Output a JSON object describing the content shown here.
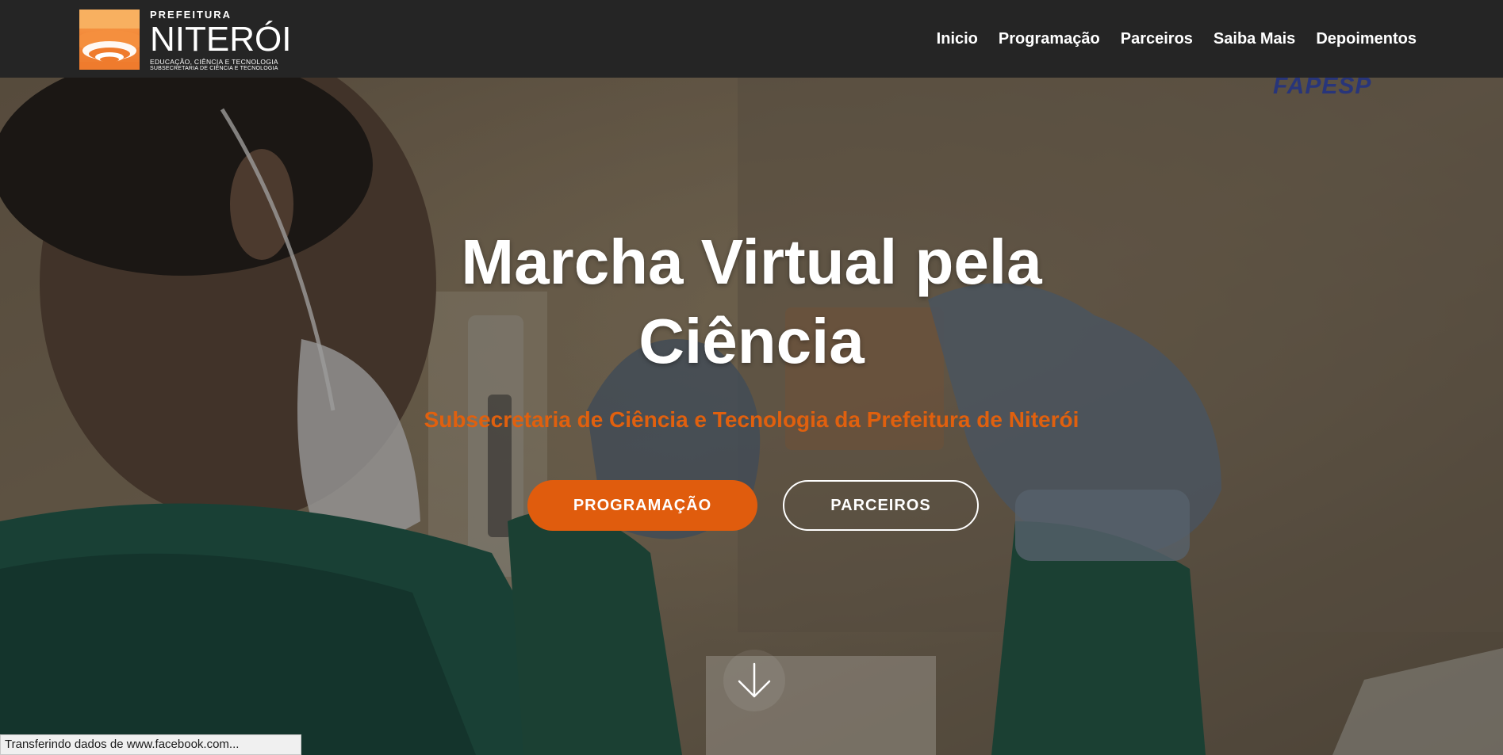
{
  "header": {
    "logo": {
      "pre_title": "PREFEITURA",
      "name": "NITERÓI",
      "subtitle1": "EDUCAÇÃO, CIÊNCIA E TECNOLOGIA",
      "subtitle2": "SUBSECRETARIA DE CIÊNCIA E TECNOLOGIA"
    },
    "nav": [
      "Inicio",
      "Programação",
      "Parceiros",
      "Saiba Mais",
      "Depoimentos"
    ]
  },
  "hero": {
    "background_text": "FAPESP",
    "title_line1": "Marcha Virtual pela",
    "title_line2": "Ciência",
    "subtitle": "Subsecretaria de Ciência e Tecnologia da Prefeitura de Niterói",
    "primary_button": "PROGRAMAÇÃO",
    "secondary_button": "PARCEIROS",
    "scroll_icon": "arrow-down-icon"
  },
  "status_bar": {
    "text": "Transferindo dados de www.facebook.com..."
  },
  "colors": {
    "header_bg": "#252525",
    "accent": "#e05c0d",
    "logo_orange": "#f3893a"
  }
}
